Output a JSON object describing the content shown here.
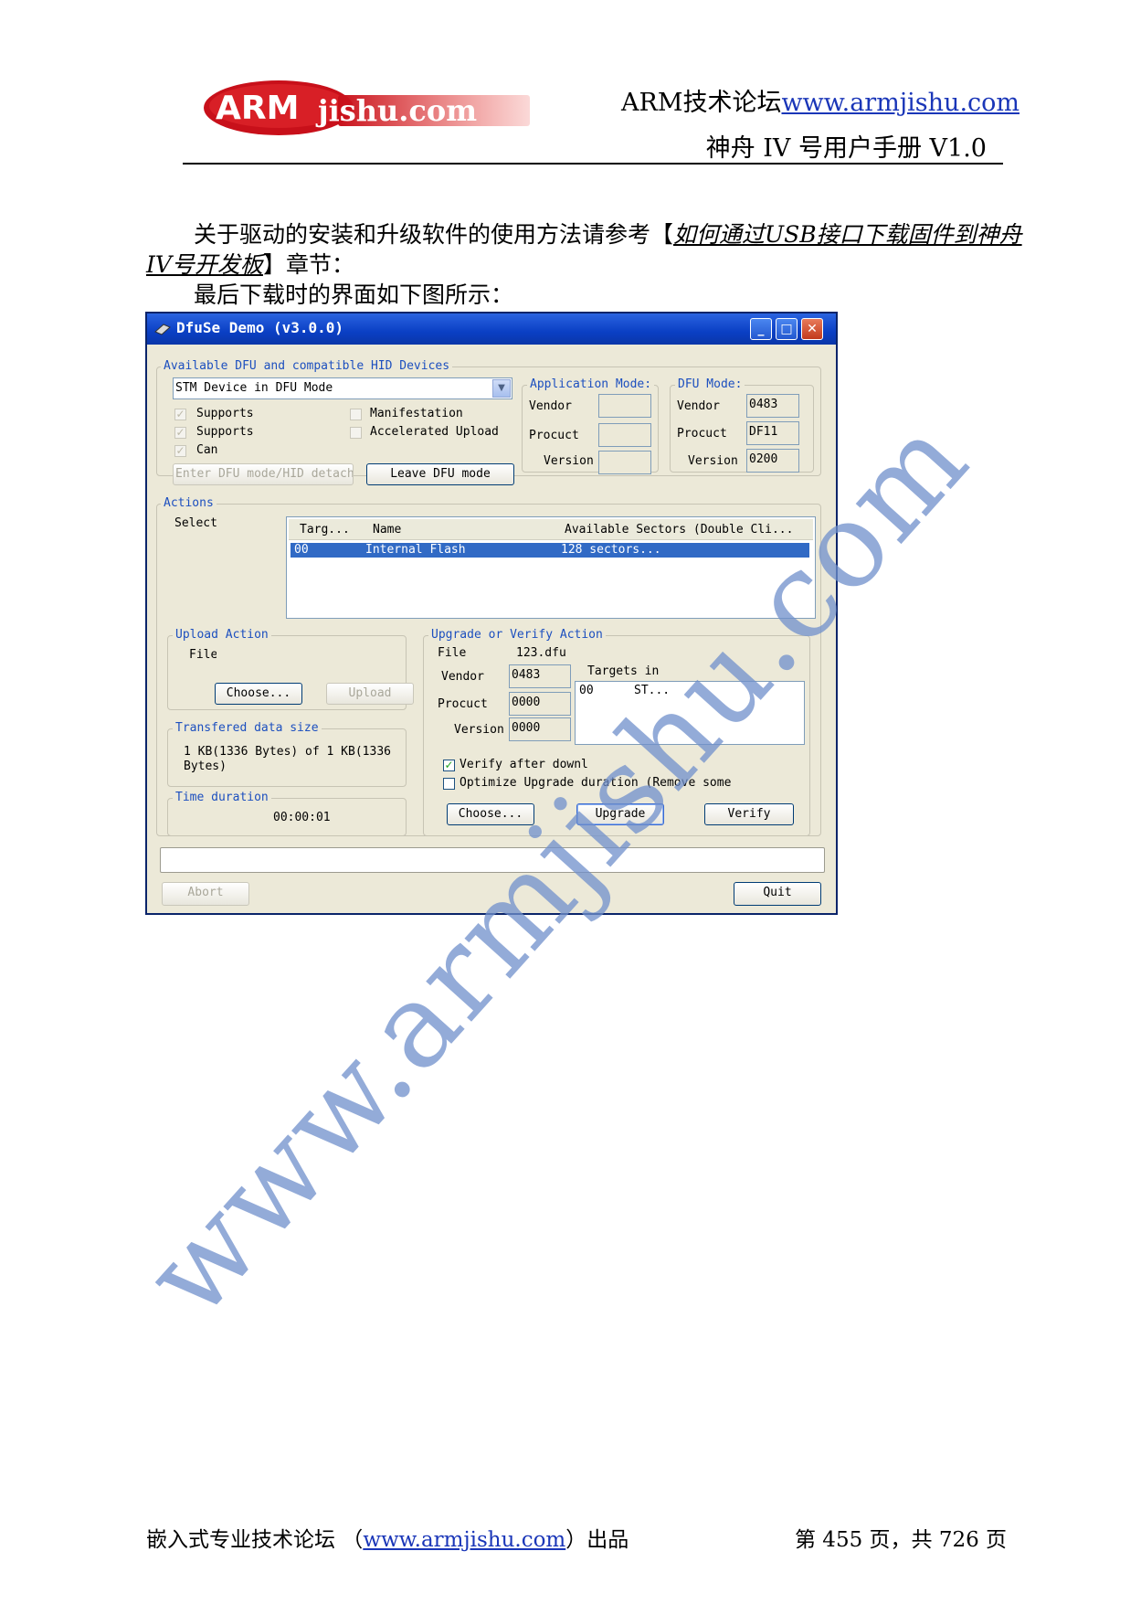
{
  "header": {
    "logo_text": "ARMjishu.com",
    "forum_name": "ARM技术论坛",
    "forum_url": "www.armjishu.com",
    "manual_title": "神舟 IV 号用户手册 V1.0"
  },
  "body": {
    "para1_prefix": "关于驱动的安装和升级软件的使用方法请参考【",
    "para1_link": "如何通过USB接口下载固件到神舟IV号开发板",
    "para1_suffix": "】章节：",
    "para2": "最后下载时的界面如下图所示："
  },
  "window": {
    "title": "DfuSe Demo (v3.0.0)",
    "devices_group": {
      "title": "Available DFU and compatible HID Devices",
      "selected_device": "STM Device in DFU Mode",
      "checks": [
        {
          "label": "Supports",
          "checked": true
        },
        {
          "label": "Supports",
          "checked": true
        },
        {
          "label": "Can",
          "checked": true
        },
        {
          "label": "Manifestation",
          "checked": false
        },
        {
          "label": "Accelerated Upload",
          "checked": false
        }
      ],
      "enter_button": "Enter DFU mode/HID detach",
      "leave_button": "Leave DFU mode"
    },
    "app_mode": {
      "title": "Application Mode:",
      "vendor_label": "Vendor",
      "product_label": "Procuct",
      "version_label": "Version",
      "vendor": "",
      "product": "",
      "version": ""
    },
    "dfu_mode": {
      "title": "DFU Mode:",
      "vendor_label": "Vendor",
      "product_label": "Procuct",
      "version_label": "Version",
      "vendor": "0483",
      "product": "DF11",
      "version": "0200"
    },
    "actions": {
      "title": "Actions",
      "select_label": "Select",
      "columns": [
        "Targ...",
        "Name",
        "Available Sectors (Double Cli..."
      ],
      "rows": [
        {
          "target": "00",
          "name": "Internal Flash",
          "sectors": "128 sectors..."
        }
      ]
    },
    "upload_action": {
      "title": "Upload Action",
      "file_label": "File",
      "choose_button": "Choose...",
      "upload_button": "Upload"
    },
    "transferred": {
      "title": "Transfered data size",
      "value_line1": "1 KB(1336 Bytes) of 1 KB(1336",
      "value_line2": "Bytes)"
    },
    "time_duration": {
      "title": "Time duration",
      "value": "00:00:01"
    },
    "upgrade_action": {
      "title": "Upgrade or Verify Action",
      "file_label": "File",
      "file_value": "123.dfu",
      "vendor_label": "Vendor",
      "vendor": "0483",
      "product_label": "Procuct",
      "product": "0000",
      "version_label": "Version",
      "version": "0000",
      "targets_label": "Targets in",
      "targets": [
        {
          "id": "00",
          "name": "ST..."
        }
      ],
      "verify_label": "Verify after downl",
      "verify_checked": true,
      "optimize_label": "Optimize Upgrade duration (Remove some",
      "optimize_checked": false,
      "choose_button": "Choose...",
      "upgrade_button": "Upgrade",
      "verify_button": "Verify"
    },
    "abort_button": "Abort",
    "quit_button": "Quit"
  },
  "watermark": "www.armjishu.com",
  "footer": {
    "left_prefix": "嵌入式专业技术论坛 （",
    "left_url": "www.armjishu.com",
    "left_suffix": "）出品",
    "page_info": "第 455 页，共 726 页"
  }
}
